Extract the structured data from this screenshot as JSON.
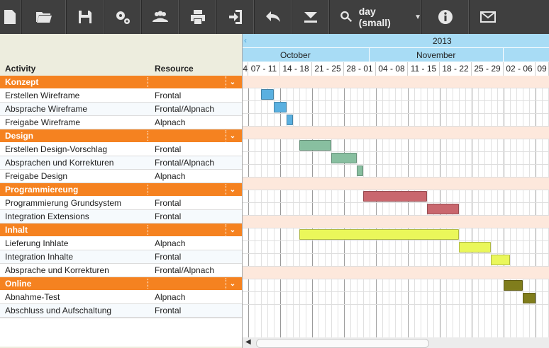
{
  "toolbar": {
    "buttons": [
      "new-icon",
      "open-folder-icon",
      "save-icon",
      "settings-icon",
      "users-icon",
      "print-icon",
      "export-icon",
      "undo-icon",
      "collapse-icon"
    ],
    "zoom_label": "day (small)",
    "right_buttons": [
      "info-icon",
      "mail-icon"
    ]
  },
  "grid": {
    "col_activity": "Activity",
    "col_resource": "Resource"
  },
  "timeline": {
    "year": "2013",
    "months": [
      "October",
      "November"
    ],
    "weeks": [
      "4",
      "07 - 11",
      "14 - 18",
      "21 - 25",
      "28 - 01",
      "04 - 08",
      "11 - 15",
      "18 - 22",
      "25 - 29",
      "02 - 06",
      "09"
    ]
  },
  "groups": [
    {
      "name": "Konzept",
      "tasks": [
        {
          "name": "Erstellen Wireframe",
          "resource": "Frontal",
          "start": 2,
          "days": 2,
          "color": "#5ab0e0"
        },
        {
          "name": "Absprache Wireframe",
          "resource": "Frontal/Alpnach",
          "start": 4,
          "days": 2,
          "color": "#5ab0e0"
        },
        {
          "name": "Freigabe Wireframe",
          "resource": "Alpnach",
          "start": 6,
          "days": 1,
          "color": "#5ab0e0"
        }
      ]
    },
    {
      "name": "Design",
      "tasks": [
        {
          "name": "Erstellen Design-Vorschlag",
          "resource": "Frontal",
          "start": 8,
          "days": 5,
          "color": "#88bfa0"
        },
        {
          "name": "Absprachen und Korrekturen",
          "resource": "Frontal/Alpnach",
          "start": 13,
          "days": 4,
          "color": "#88bfa0"
        },
        {
          "name": "Freigabe Design",
          "resource": "Alpnach",
          "start": 17,
          "days": 1,
          "color": "#88bfa0"
        }
      ]
    },
    {
      "name": "Programmiereung",
      "tasks": [
        {
          "name": "Programmierung Grundsystem",
          "resource": "Frontal",
          "start": 18,
          "days": 10,
          "color": "#c9676e"
        },
        {
          "name": "Integration Extensions",
          "resource": "Frontal",
          "start": 28,
          "days": 5,
          "color": "#c9676e"
        }
      ]
    },
    {
      "name": "Inhalt",
      "tasks": [
        {
          "name": "Lieferung Inhlate",
          "resource": "Alpnach",
          "start": 8,
          "days": 25,
          "color": "#eaf75a"
        },
        {
          "name": "Integration Inhalte",
          "resource": "Frontal",
          "start": 33,
          "days": 5,
          "color": "#eaf75a"
        },
        {
          "name": "Absprache und Korrekturen",
          "resource": "Frontal/Alpnach",
          "start": 38,
          "days": 3,
          "color": "#eaf75a"
        }
      ]
    },
    {
      "name": "Online",
      "tasks": [
        {
          "name": "Abnahme-Test",
          "resource": "Alpnach",
          "start": 40,
          "days": 3,
          "color": "#807d1c"
        },
        {
          "name": "Abschluss und Aufschaltung",
          "resource": "Frontal",
          "start": 43,
          "days": 2,
          "color": "#807d1c"
        }
      ]
    }
  ],
  "colors": {
    "group_bg": "#f58220",
    "header_blue": "#a8dcf5",
    "group_row_chart": "#fde8dc"
  }
}
